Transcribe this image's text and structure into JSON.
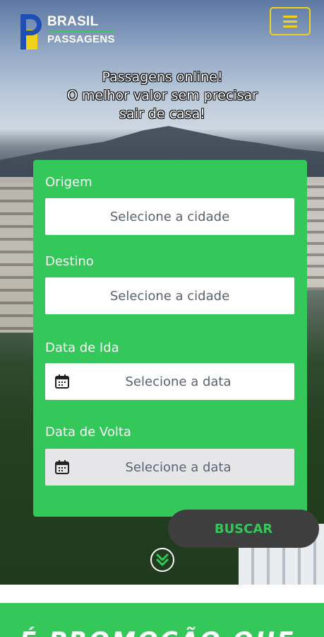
{
  "brand": {
    "name_top": "BRASIL",
    "name_bottom": "PASSAGENS"
  },
  "colors": {
    "accent_green": "#34c759",
    "brand_blue": "#1f4fb4",
    "brand_yellow": "#f1d21a",
    "button_dark": "#3e3e3e"
  },
  "header": {
    "menu_icon": "hamburger-menu-icon"
  },
  "hero": {
    "title_line1": "Passagens online!",
    "title_line2": "O melhor valor sem precisar",
    "title_line3": "sair de casa!"
  },
  "search": {
    "origin": {
      "label": "Origem",
      "placeholder": "Selecione a cidade"
    },
    "destination": {
      "label": "Destino",
      "placeholder": "Selecione a cidade"
    },
    "departure": {
      "label": "Data de Ida",
      "placeholder": "Selecione a data",
      "icon": "calendar-icon"
    },
    "return": {
      "label": "Data de Volta",
      "placeholder": "Selecione a data",
      "icon": "calendar-icon"
    },
    "submit_label": "BUSCAR"
  },
  "scroll_icon": "double-chevron-down-icon",
  "promo": {
    "text": "É PROMOÇÃO QUE"
  }
}
